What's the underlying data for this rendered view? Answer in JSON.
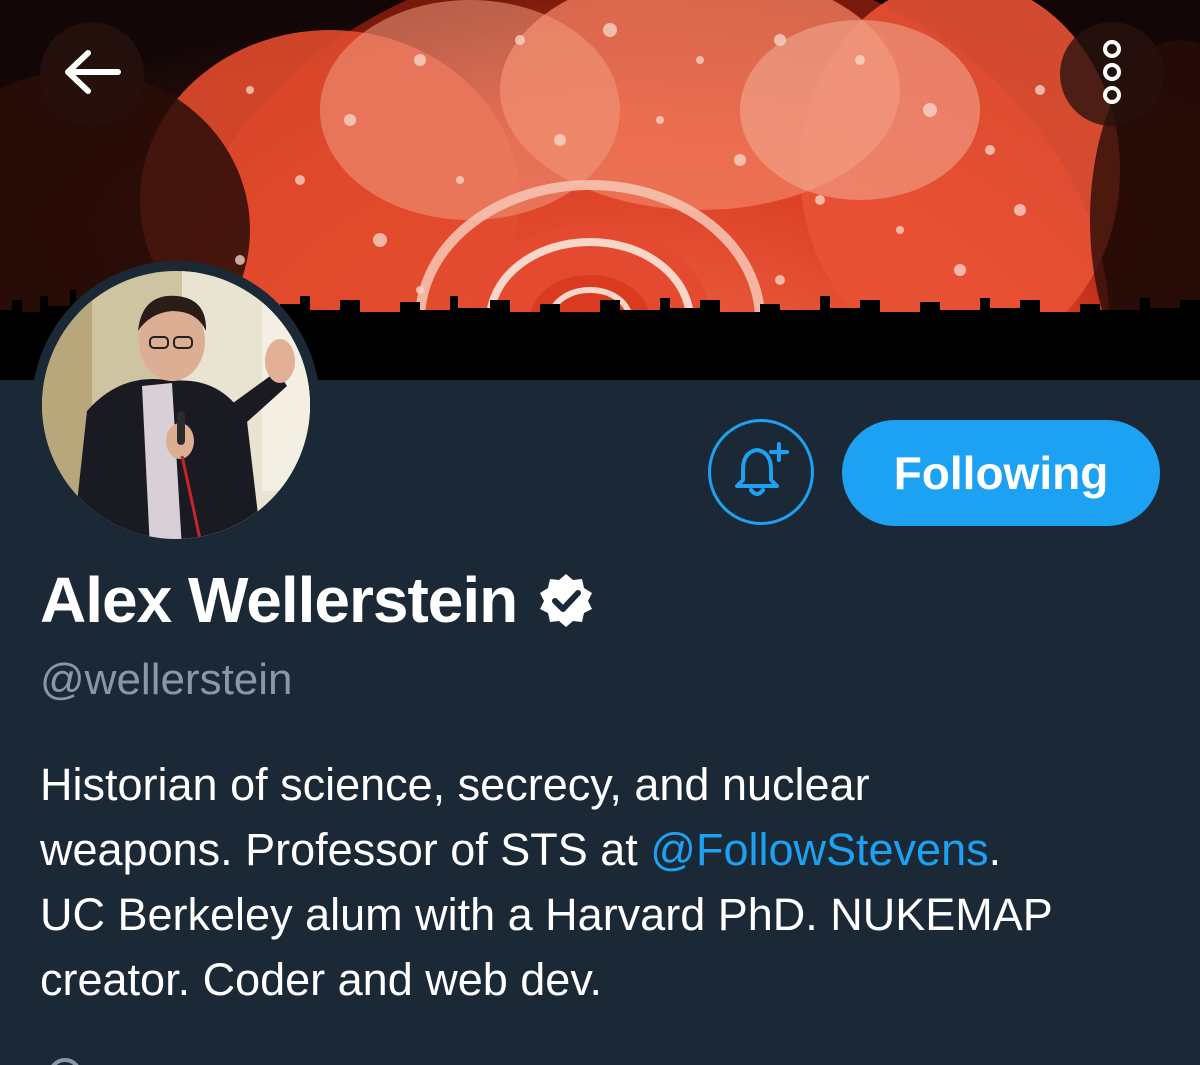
{
  "profile": {
    "display_name": "Alex Wellerstein",
    "handle": "@wellerstein",
    "verified": true,
    "bio": {
      "line1": "Historian of science, secrecy, and nuclear",
      "line2_before": "weapons. Professor of STS at ",
      "line2_mention": "@FollowStevens",
      "line2_after": ".",
      "line3": "UC Berkeley alum with a Harvard PhD. NUKEMAP",
      "line4": "creator. Coder and web dev."
    }
  },
  "actions": {
    "follow_label": "Following",
    "back_icon": "arrow-left-icon",
    "more_icon": "more-vertical-icon",
    "notify_icon": "bell-plus-icon"
  },
  "colors": {
    "background": "#1b2836",
    "accent": "#1da1f2",
    "secondary_text": "#8899a6",
    "banner_red": "#e0462c"
  }
}
